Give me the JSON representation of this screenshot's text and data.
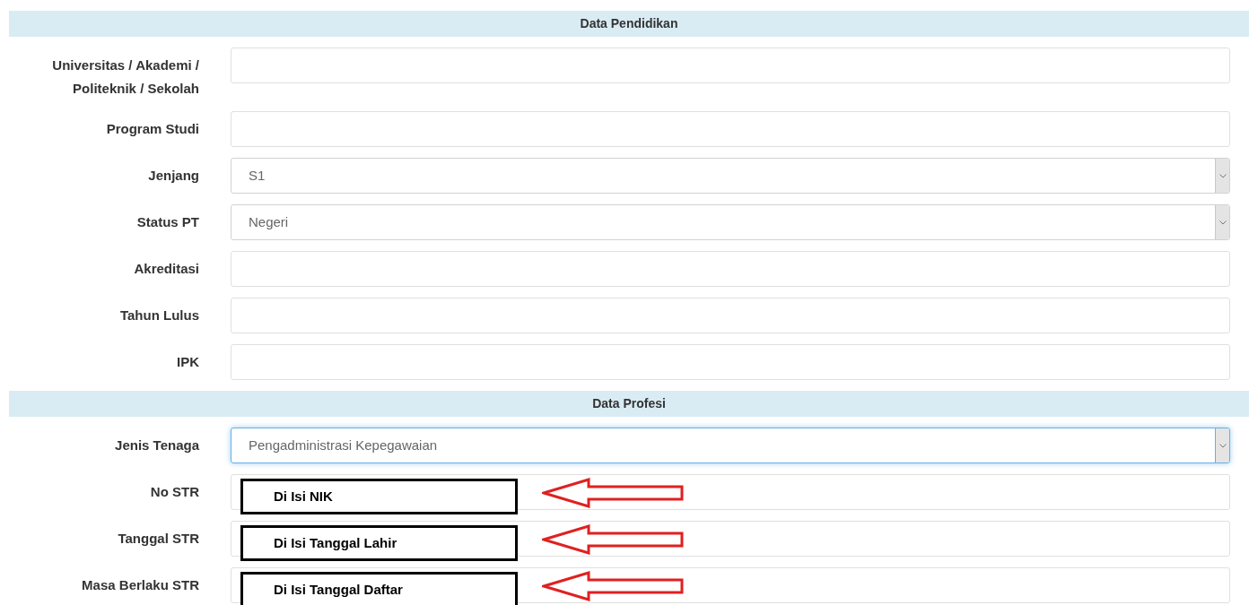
{
  "sections": [
    {
      "title": "Data Pendidikan",
      "rows": [
        {
          "label": "Universitas / Akademi / Politeknik / Sekolah",
          "kind": "text"
        },
        {
          "label": "Program Studi",
          "kind": "text"
        },
        {
          "label": "Jenjang",
          "kind": "select",
          "value": "S1",
          "focused": false
        },
        {
          "label": "Status PT",
          "kind": "select",
          "value": "Negeri",
          "focused": false
        },
        {
          "label": "Akreditasi",
          "kind": "text"
        },
        {
          "label": "Tahun Lulus",
          "kind": "text"
        },
        {
          "label": "IPK",
          "kind": "text"
        }
      ]
    },
    {
      "title": "Data Profesi",
      "rows": [
        {
          "label": "Jenis Tenaga",
          "kind": "select",
          "value": "Pengadministrasi Kepegawaian",
          "focused": true
        },
        {
          "label": "No STR",
          "kind": "text",
          "callout": "Di Isi NIK"
        },
        {
          "label": "Tanggal STR",
          "kind": "text",
          "callout": "Di Isi Tanggal Lahir"
        },
        {
          "label": "Masa Berlaku STR",
          "kind": "text",
          "callout": "Di Isi Tanggal Daftar"
        }
      ]
    }
  ]
}
